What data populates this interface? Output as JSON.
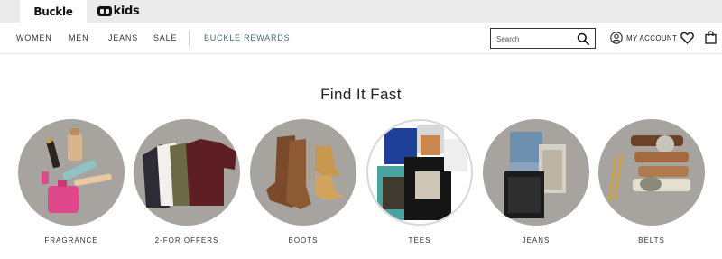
{
  "brand_tabs": [
    {
      "label": "Buckle",
      "active": true
    },
    {
      "label": "kids",
      "active": false
    }
  ],
  "nav": {
    "links": [
      "WOMEN",
      "MEN",
      "JEANS",
      "SALE"
    ],
    "rewards": "BUCKLE REWARDS",
    "account": "MY ACCOUNT"
  },
  "search": {
    "placeholder": "Search",
    "value": ""
  },
  "heading": "Find It Fast",
  "categories": [
    {
      "label": "FRAGRANCE"
    },
    {
      "label": "2-FOR OFFERS"
    },
    {
      "label": "BOOTS"
    },
    {
      "label": "TEES"
    },
    {
      "label": "JEANS"
    },
    {
      "label": "BELTS"
    }
  ],
  "colors": {
    "accent": "#3f6f72",
    "circle_bg": "#a7a39f",
    "tab_bar": "#ebebeb"
  }
}
